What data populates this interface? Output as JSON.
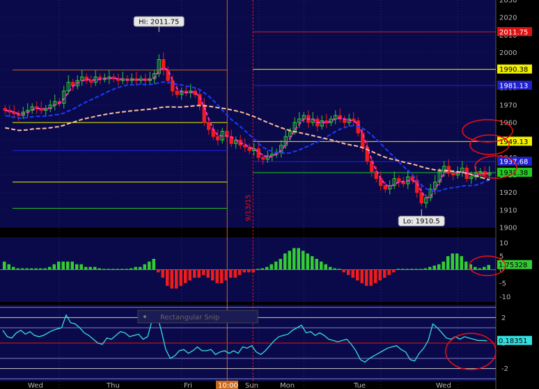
{
  "snip_overlay": {
    "label": "Rectangular Snip"
  },
  "colors": {
    "bg": "#0a0a4a",
    "axis_bg": "#000000",
    "grid": "#2a2a7a",
    "up": "#33cc33",
    "down": "#ee1c1c",
    "ma_pink": "#ff33cc",
    "ma_blue": "#1a3cff",
    "ma_peach": "#ffbfa0",
    "cyan": "#33e0e0",
    "annot": "#ee1111",
    "yellow": "#f0f000",
    "red_line": "#cc2020",
    "blue_line": "#2020ee",
    "green_line": "#22cc22",
    "orange": "#cc6a1a"
  },
  "chart_data": [
    {
      "type": "candlestick",
      "panel": "price",
      "ylim": [
        1900,
        2030
      ],
      "y_ticks": [
        1900,
        1910,
        1920,
        1930,
        1940,
        1950,
        1960,
        1970,
        1980,
        1990,
        2000,
        2010,
        2020,
        2030
      ],
      "x_day_labels": [
        "Wed",
        "Thu",
        "Fri",
        "Sun",
        "Mon",
        "Tue",
        "Wed"
      ],
      "time_marker": "10:00",
      "date_marker": "9/13/15",
      "closes": [
        1967,
        1966,
        1965,
        1964,
        1966,
        1967,
        1969,
        1968,
        1967,
        1968,
        1970,
        1972,
        1971,
        1978,
        1983,
        1981,
        1984,
        1986,
        1984,
        1983,
        1986,
        1985,
        1985,
        1986,
        1985,
        1984,
        1985,
        1984,
        1985,
        1984,
        1985,
        1984,
        1985,
        1988,
        1996,
        1990,
        1984,
        1978,
        1976,
        1978,
        1977,
        1978,
        1976,
        1970,
        1960,
        1956,
        1952,
        1950,
        1955,
        1952,
        1948,
        1950,
        1947,
        1946,
        1944,
        1945,
        1940,
        1939,
        1941,
        1942,
        1943,
        1947,
        1952,
        1955,
        1960,
        1962,
        1964,
        1960,
        1962,
        1958,
        1961,
        1960,
        1962,
        1964,
        1962,
        1960,
        1962,
        1961,
        1954,
        1946,
        1938,
        1932,
        1928,
        1924,
        1922,
        1924,
        1928,
        1926,
        1925,
        1929,
        1927,
        1920,
        1914,
        1917,
        1922,
        1926,
        1932,
        1935,
        1931,
        1930,
        1932,
        1934,
        1928,
        1929,
        1931,
        1932,
        1930,
        1931
      ],
      "panel_high": 2011.75,
      "panel_low": 1910.5,
      "horizontal_levels": [
        {
          "value": 2011.75,
          "color": "red"
        },
        {
          "value": 1990.38,
          "color": "yellow"
        },
        {
          "value": 1981.13,
          "color": "blue"
        },
        {
          "value": 1949.13,
          "color": "yellow"
        },
        {
          "value": 1937.68,
          "color": "blue"
        },
        {
          "value": 1931.38,
          "color": "green"
        }
      ],
      "previous_session_levels": [
        {
          "value": 1990.0,
          "color": "orange"
        },
        {
          "value": 1960.0,
          "color": "yellow"
        },
        {
          "value": 1944.0,
          "color": "blue"
        },
        {
          "value": 1926.0,
          "color": "yellow"
        },
        {
          "value": 1911.0,
          "color": "green"
        }
      ],
      "price_tags": [
        {
          "text": "2011.75",
          "value": 2011.75,
          "bg": "#dd1111",
          "fg": "#ffffff"
        },
        {
          "text": "1990.38",
          "value": 1990.38,
          "bg": "#f0f000",
          "fg": "#000000"
        },
        {
          "text": "1981.13",
          "value": 1981.13,
          "bg": "#2020cc",
          "fg": "#ffffff"
        },
        {
          "text": "1949.13",
          "value": 1949.13,
          "bg": "#f0f000",
          "fg": "#000000"
        },
        {
          "text": "1937.68",
          "value": 1937.68,
          "bg": "#2020cc",
          "fg": "#ffffff"
        },
        {
          "text": "1931.38",
          "value": 1931.38,
          "bg": "#22cc22",
          "fg": "#000000"
        }
      ],
      "callouts": [
        {
          "text": "Hi: 2011.75",
          "index": 34,
          "value": 2011.75,
          "position": "above"
        },
        {
          "text": "Lo: 1910.5",
          "index": 92,
          "value": 1910.5,
          "position": "below"
        }
      ]
    },
    {
      "type": "histogram",
      "panel": "momentum",
      "ylim": [
        -12,
        12
      ],
      "y_ticks": [
        -10,
        -5,
        0,
        5,
        10
      ],
      "last_value": "1.75328",
      "values": [
        3,
        2,
        1,
        0.5,
        0.5,
        0.5,
        0.5,
        0.5,
        0.5,
        0.5,
        1,
        2,
        3,
        3,
        3,
        3,
        2,
        2,
        1,
        1,
        1,
        0.5,
        0.3,
        0.3,
        0.3,
        0.3,
        0.3,
        0.3,
        0.5,
        1,
        1,
        2,
        3,
        4,
        -1,
        -3,
        -6,
        -7,
        -7,
        -6,
        -5,
        -4,
        -3,
        -3,
        -2,
        -3,
        -4,
        -5,
        -5,
        -4,
        -3,
        -3,
        -2,
        -1,
        -1,
        -1,
        0.3,
        0.5,
        1,
        2,
        3,
        4,
        6,
        7,
        8,
        8,
        7,
        6,
        5,
        4,
        3,
        2,
        1,
        0.5,
        0.3,
        -1,
        -2,
        -3,
        -4,
        -5,
        -6,
        -6,
        -5,
        -4,
        -3,
        -2,
        -1,
        0.3,
        0.3,
        0.3,
        0.3,
        0.3,
        0.3,
        0.5,
        1,
        1.5,
        2,
        3,
        5,
        6,
        6,
        5,
        3,
        2,
        1,
        0.5,
        1,
        1.75
      ],
      "has_zero_line": true
    },
    {
      "type": "line",
      "panel": "oscillator",
      "ylim": [
        -3,
        3
      ],
      "y_ticks": [
        -2,
        0,
        2
      ],
      "last_value": "0.18351",
      "reference_levels": [
        2.8,
        2.0,
        1.2,
        0,
        -1.2,
        -2.0,
        -2.8
      ],
      "values": [
        1.0,
        0.5,
        0.4,
        0.8,
        1.0,
        0.7,
        0.9,
        0.6,
        0.5,
        0.6,
        0.8,
        1.0,
        1.1,
        1.2,
        2.2,
        1.6,
        1.5,
        1.2,
        0.8,
        0.6,
        0.3,
        0.0,
        -0.1,
        0.4,
        0.3,
        0.6,
        0.9,
        0.8,
        0.5,
        0.6,
        0.7,
        0.3,
        0.5,
        1.8,
        2.3,
        1.0,
        -0.5,
        -1.2,
        -1.0,
        -0.6,
        -0.5,
        -0.8,
        -0.6,
        -0.3,
        -0.6,
        -0.6,
        -0.5,
        -0.9,
        -0.7,
        -0.6,
        -0.8,
        -0.6,
        -0.8,
        -0.3,
        -0.4,
        -0.2,
        -0.7,
        -0.9,
        -0.6,
        -0.2,
        0.2,
        0.5,
        0.6,
        0.7,
        1.0,
        1.2,
        1.4,
        0.8,
        0.9,
        0.6,
        0.8,
        0.6,
        0.3,
        0.2,
        0.1,
        0.2,
        0.3,
        -0.1,
        -0.6,
        -1.3,
        -1.5,
        -1.2,
        -1.0,
        -0.8,
        -0.6,
        -0.4,
        -0.3,
        -0.2,
        -0.5,
        -0.7,
        -1.3,
        -1.4,
        -0.8,
        -0.4,
        0.2,
        1.5,
        1.2,
        0.8,
        0.4,
        0.3,
        0.5,
        0.3,
        0.5,
        0.4,
        0.3,
        0.2,
        0.2,
        0.18
      ]
    }
  ]
}
